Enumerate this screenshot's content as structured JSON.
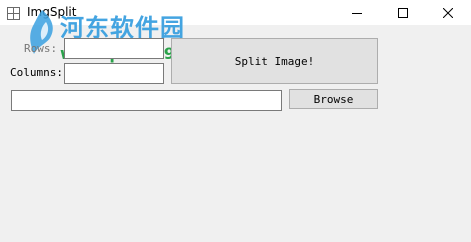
{
  "window": {
    "title": "ImgSplit"
  },
  "watermark": {
    "site_name": "河东软件园",
    "url": "www.pc0359.cn"
  },
  "form": {
    "rows_label": "Rows:",
    "rows_value": "",
    "columns_label": "Columns:",
    "columns_value": "",
    "split_button_label": "Split Image!",
    "path_value": "",
    "browse_button_label": "Browse"
  },
  "icons": {
    "app": "app-icon",
    "minimize": "minimize-icon",
    "maximize": "maximize-icon",
    "close": "close-icon"
  }
}
